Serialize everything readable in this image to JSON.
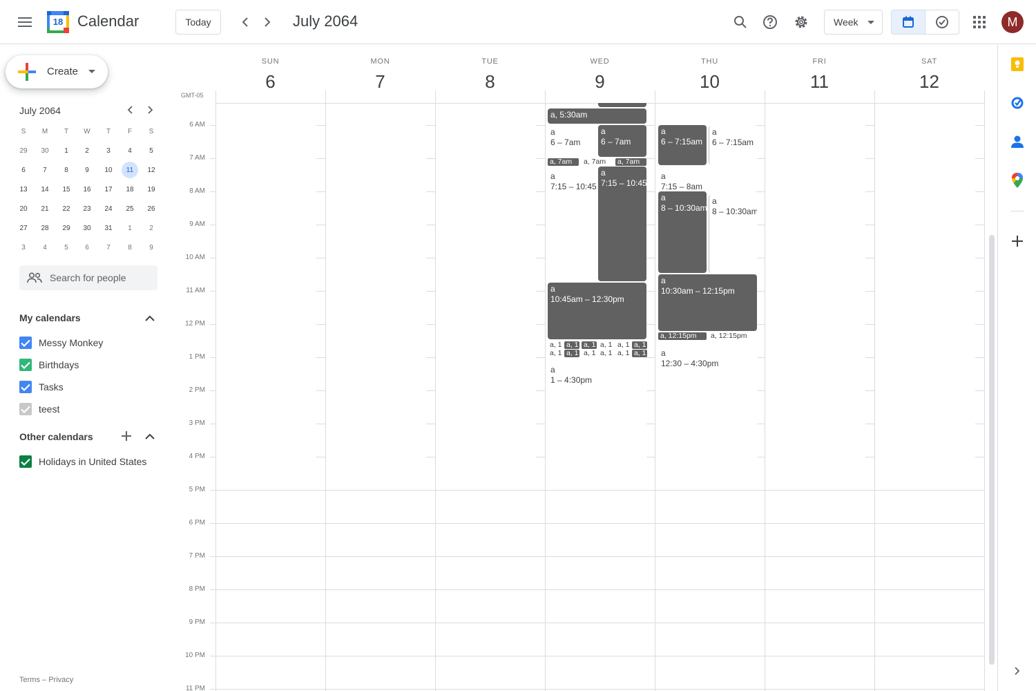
{
  "header": {
    "app_title": "Calendar",
    "logo_day": "18",
    "today_label": "Today",
    "month_title": "July 2064",
    "view_label": "Week",
    "avatar_initial": "M"
  },
  "sidebar": {
    "create_label": "Create",
    "mini_month_title": "July 2064",
    "mini_dow": [
      "S",
      "M",
      "T",
      "W",
      "T",
      "F",
      "S"
    ],
    "mini_days": [
      [
        "29",
        "30",
        "1",
        "2",
        "3",
        "4",
        "5"
      ],
      [
        "6",
        "7",
        "8",
        "9",
        "10",
        "11",
        "12"
      ],
      [
        "13",
        "14",
        "15",
        "16",
        "17",
        "18",
        "19"
      ],
      [
        "20",
        "21",
        "22",
        "23",
        "24",
        "25",
        "26"
      ],
      [
        "27",
        "28",
        "29",
        "30",
        "31",
        "1",
        "2"
      ],
      [
        "3",
        "4",
        "5",
        "6",
        "7",
        "8",
        "9"
      ]
    ],
    "search_people_placeholder": "Search for people",
    "my_calendars_title": "My calendars",
    "my_calendars": [
      {
        "label": "Messy Monkey",
        "color": "#4285f4",
        "checked": true
      },
      {
        "label": "Birthdays",
        "color": "#33b679",
        "checked": true
      },
      {
        "label": "Tasks",
        "color": "#4285f4",
        "checked": true
      },
      {
        "label": "teest",
        "color": "#c8c8c8",
        "checked": true
      }
    ],
    "other_calendars_title": "Other calendars",
    "other_calendars": [
      {
        "label": "Holidays in United States",
        "color": "#0b8043",
        "checked": true
      }
    ],
    "footer_terms": "Terms",
    "footer_sep": "–",
    "footer_privacy": "Privacy"
  },
  "week": {
    "timezone": "GMT-05",
    "days": [
      {
        "dow": "SUN",
        "num": "6"
      },
      {
        "dow": "MON",
        "num": "7"
      },
      {
        "dow": "TUE",
        "num": "8"
      },
      {
        "dow": "WED",
        "num": "9"
      },
      {
        "dow": "THU",
        "num": "10"
      },
      {
        "dow": "FRI",
        "num": "11"
      },
      {
        "dow": "SAT",
        "num": "12"
      }
    ],
    "hours": [
      "6 AM",
      "7 AM",
      "8 AM",
      "9 AM",
      "10 AM",
      "11 AM",
      "12 PM",
      "1 PM",
      "2 PM",
      "3 PM",
      "4 PM",
      "5 PM",
      "6 PM",
      "7 PM",
      "8 PM",
      "9 PM",
      "10 PM",
      "11 PM"
    ]
  },
  "events": {
    "wed_530": "a, 5:30am",
    "wed_a1_title": "a",
    "wed_a1_time": "6 – 7am",
    "wed_a2_title": "a",
    "wed_a2_time": "6 – 7am",
    "wed_7am_1": "a, 7am",
    "wed_7am_2": "a, 7am",
    "wed_7am_3": "a, 7am",
    "wed_b1_title": "a",
    "wed_b1_time": "7:15 – 10:45",
    "wed_b2_title": "a",
    "wed_b2_time": "7:15 – 10:45",
    "wed_c_title": "a",
    "wed_c_time": "10:45am – 12:30pm",
    "wed_tiny": "a, 1",
    "wed_d_title": "a",
    "wed_d_time": "1 – 4:30pm",
    "thu_a1_title": "a",
    "thu_a1_time": "6 – 7:15am",
    "thu_a2_title": "a",
    "thu_a2_time": "6 – 7:15am",
    "thu_b_title": "a",
    "thu_b_time": "7:15 – 8am",
    "thu_c1_title": "a",
    "thu_c1_time": "8 – 10:30am",
    "thu_c2_title": "a",
    "thu_c2_time": "8 – 10:30am",
    "thu_d_title": "a",
    "thu_d_time": "10:30am – 12:15pm",
    "thu_e1": "a, 12:15pm",
    "thu_e2": "a, 12:15pm",
    "thu_f_title": "a",
    "thu_f_time": "12:30 – 4:30pm"
  }
}
